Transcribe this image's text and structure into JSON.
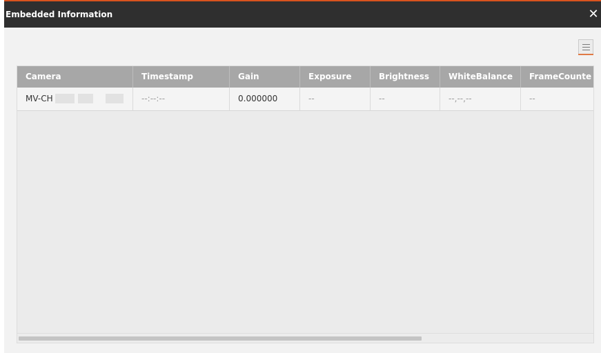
{
  "dialog": {
    "title": "Embedded Information",
    "close_glyph": "✕",
    "close_icon": "close-icon",
    "menu_icon": "list-menu-icon",
    "accent_color": "#d9531e"
  },
  "table": {
    "columns": [
      "Camera",
      "Timestamp",
      "Gain",
      "Exposure",
      "Brightness",
      "WhiteBalance",
      "FrameCounte"
    ],
    "rows": [
      {
        "camera": "MV-CH",
        "timestamp": "--:--:--",
        "gain": "0.000000",
        "exposure": "--",
        "brightness": "--",
        "whitebalance": "--,--,--",
        "framecounter": "--"
      }
    ]
  }
}
